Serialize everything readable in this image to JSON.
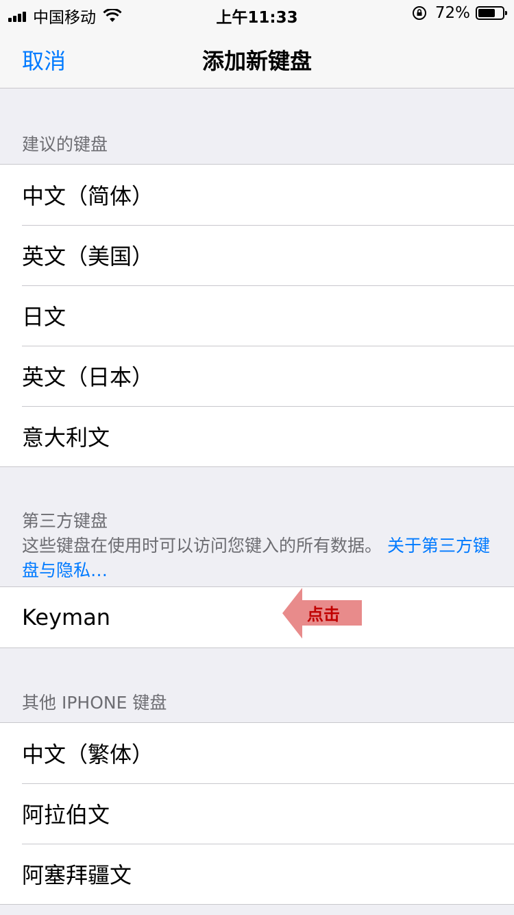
{
  "status_bar": {
    "carrier": "中国移动",
    "time": "上午11:33",
    "battery_percent": "72%",
    "battery_level": 0.72,
    "icons": [
      "signal-icon",
      "wifi-icon",
      "orientation-lock-icon",
      "battery-icon"
    ]
  },
  "nav": {
    "cancel_label": "取消",
    "title": "添加新键盘"
  },
  "suggested": {
    "header": "建议的键盘",
    "items": [
      "中文（简体）",
      "英文（美国）",
      "日文",
      "英文（日本）",
      "意大利文"
    ]
  },
  "third_party": {
    "header": "第三方键盘",
    "description": "这些键盘在使用时可以访问您键入的所有数据。",
    "link": "关于第三方键盘与隐私…",
    "items": [
      "Keyman"
    ]
  },
  "annotation": {
    "label": "点击",
    "color": "#e88b8b"
  },
  "other": {
    "header": "其他 IPHONE 键盘",
    "items": [
      "中文（繁体）",
      "阿拉伯文",
      "阿塞拜疆文"
    ]
  },
  "colors": {
    "accent": "#007aff",
    "background": "#efeff4",
    "header_text": "#6d6d72"
  }
}
